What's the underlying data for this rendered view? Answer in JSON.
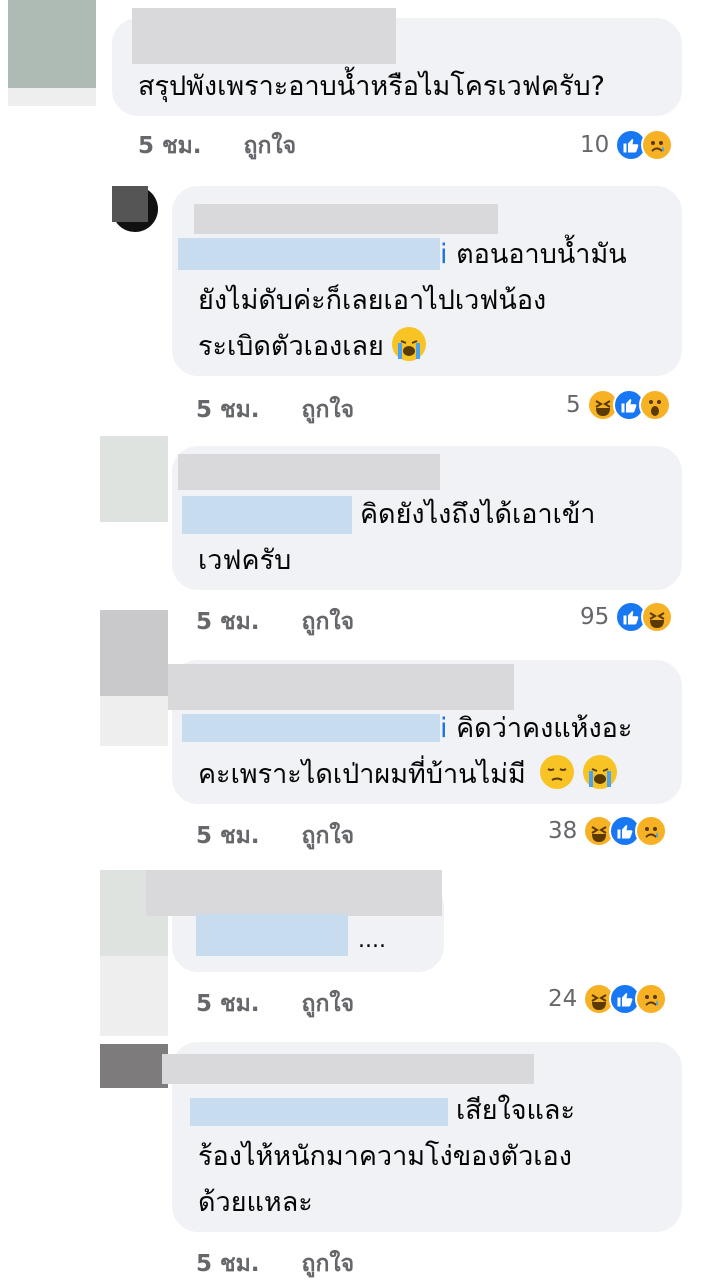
{
  "comments": [
    {
      "text_lines": [
        "สรุปพังเพราะอาบน้ำหรือไมโครเวฟครับ?"
      ],
      "time": "5 ชม.",
      "like_label": "ถูกใจ",
      "reaction_count": "10",
      "reactions": [
        "like",
        "sad"
      ]
    },
    {
      "mention_tail": "i",
      "text_lines": [
        "ตอนอาบน้ำมัน",
        "ยังไม่ดับค่ะก็เลยเอาไปเวฟน้อง",
        "ระเบิดตัวเองเลย"
      ],
      "inline_emoji": [
        "crying-face"
      ],
      "time": "5 ชม.",
      "like_label": "ถูกใจ",
      "reaction_count": "5",
      "reactions": [
        "haha",
        "like",
        "wow"
      ]
    },
    {
      "text_lines": [
        "คิดยังไงถึงได้เอาเข้า",
        "เวฟครับ"
      ],
      "time": "5 ชม.",
      "like_label": "ถูกใจ",
      "reaction_count": "95",
      "reactions": [
        "like",
        "haha"
      ]
    },
    {
      "mention_tail": "i",
      "text_lines": [
        "คิดว่าคงแห้งอะ",
        "คะเพราะไดเป่าผมที่บ้านไม่มี"
      ],
      "inline_emoji": [
        "pensive-face",
        "crying-face"
      ],
      "time": "5 ชม.",
      "like_label": "ถูกใจ",
      "reaction_count": "38",
      "reactions": [
        "haha",
        "like",
        "sad"
      ]
    },
    {
      "text_lines": [
        "...."
      ],
      "time": "5 ชม.",
      "like_label": "ถูกใจ",
      "reaction_count": "24",
      "reactions": [
        "haha",
        "like",
        "sad"
      ]
    },
    {
      "text_lines": [
        "เสียใจและ",
        "ร้องไห้หนักมาความโง่ของตัวเอง",
        "ด้วยแหละ"
      ],
      "time": "5 ชม.",
      "like_label": "ถูกใจ"
    }
  ],
  "colors": {
    "bubble": "#f0f2f5",
    "meta": "#65676b",
    "like_blue": "#1877f2",
    "emoji_yellow": "#f7b125"
  }
}
